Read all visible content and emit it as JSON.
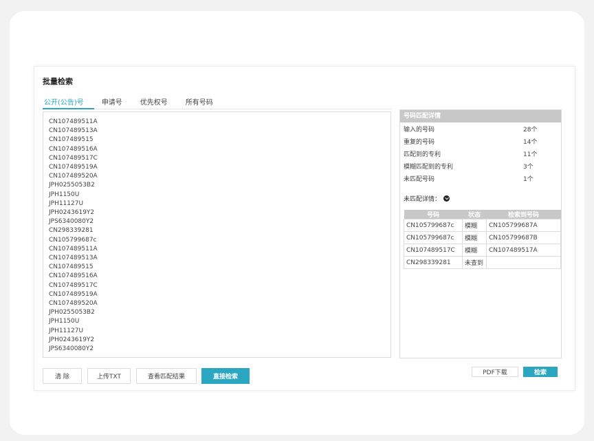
{
  "title": "批量检索",
  "tabs": [
    "公开(公告)号",
    "申请号",
    "优先权号",
    "所有号码"
  ],
  "numbers": [
    "CN107489511A",
    "CN107489513A",
    "CN107489515",
    "CN107489516A",
    "CN107489517C",
    "CN107489519A",
    "CN107489520A",
    "JPH0255053B2",
    "JPH1150U",
    "JPH11127U",
    "JPH0243619Y2",
    "JPS6340080Y2",
    "CN298339281",
    "CN105799687c",
    "CN107489511A",
    "CN107489513A",
    "CN107489515",
    "CN107489516A",
    "CN107489517C",
    "CN107489519A",
    "CN107489520A",
    "JPH0255053B2",
    "JPH1150U",
    "JPH11127U",
    "JPH0243619Y2",
    "JPS6340080Y2"
  ],
  "buttons": {
    "clear": "清  除",
    "upload": "上传TXT",
    "view_results": "查看匹配结果",
    "direct_search": "直接检索"
  },
  "summary": {
    "header": "号码匹配详情",
    "rows": [
      {
        "label": "输入的号码",
        "value": "28个"
      },
      {
        "label": "重复的号码",
        "value": "14个"
      },
      {
        "label": "匹配到的专利",
        "value": "11个"
      },
      {
        "label": "模糊匹配到的专利",
        "value": "3个"
      },
      {
        "label": "未匹配号码",
        "value": "1个"
      }
    ],
    "unmatched_label": "未匹配详情："
  },
  "detail_table": {
    "headers": [
      "号码",
      "状态",
      "检索到号码"
    ],
    "rows": [
      [
        "CN105799687c",
        "模糊",
        "CN105799687A"
      ],
      [
        "CN105799687c",
        "模糊",
        "CN105799687B"
      ],
      [
        "CN107489517C",
        "模糊",
        "CN107489517A"
      ],
      [
        "CN298339281",
        "未查到",
        ""
      ]
    ]
  },
  "right_buttons": {
    "pdf": "PDF下载",
    "search": "检索"
  },
  "colors": {
    "accent": "#2aa6c0",
    "header_gray": "#c8c8c8"
  }
}
